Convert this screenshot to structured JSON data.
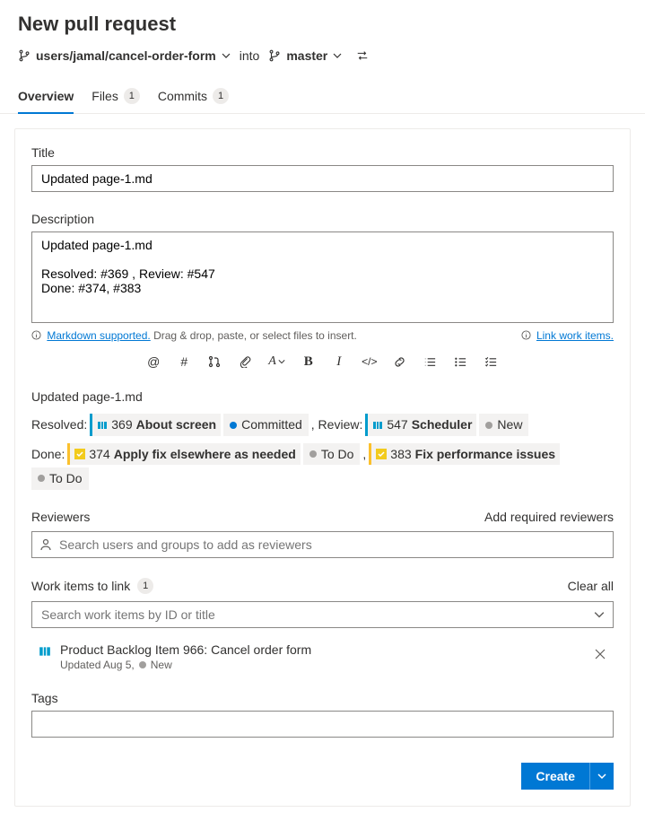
{
  "header": {
    "title": "New pull request",
    "source_branch": "users/jamal/cancel-order-form",
    "into_label": "into",
    "target_branch": "master"
  },
  "tabs": {
    "overview": "Overview",
    "files": "Files",
    "files_count": "1",
    "commits": "Commits",
    "commits_count": "1"
  },
  "form": {
    "title_label": "Title",
    "title_value": "Updated page-1.md",
    "desc_label": "Description",
    "desc_value": "Updated page-1.md\n\nResolved: #369 , Review: #547\nDone: #374, #383",
    "markdown_hint": "Markdown supported.",
    "drag_hint": " Drag & drop, paste, or select files to insert.",
    "link_work_items": "Link work items."
  },
  "preview": {
    "heading": "Updated page-1.md",
    "resolved_label": "Resolved:",
    "review_label": ", Review:",
    "done_label": "Done:",
    "items": {
      "wi369_id": "369",
      "wi369_title": "About screen",
      "wi369_status": "Committed",
      "wi547_id": "547",
      "wi547_title": "Scheduler",
      "wi547_status": "New",
      "wi374_id": "374",
      "wi374_title": "Apply fix elsewhere as needed",
      "wi374_status": "To Do",
      "wi383_id": "383",
      "wi383_title": "Fix performance issues",
      "wi383_status": "To Do"
    }
  },
  "reviewers": {
    "label": "Reviewers",
    "add_required": "Add required reviewers",
    "placeholder": "Search users and groups to add as reviewers"
  },
  "workitems": {
    "label": "Work items to link",
    "count": "1",
    "clear_all": "Clear all",
    "placeholder": "Search work items by ID or title",
    "linked": {
      "title": "Product Backlog Item 966: Cancel order form",
      "updated": "Updated Aug 5,",
      "status": "New"
    }
  },
  "tags": {
    "label": "Tags"
  },
  "actions": {
    "create": "Create"
  }
}
